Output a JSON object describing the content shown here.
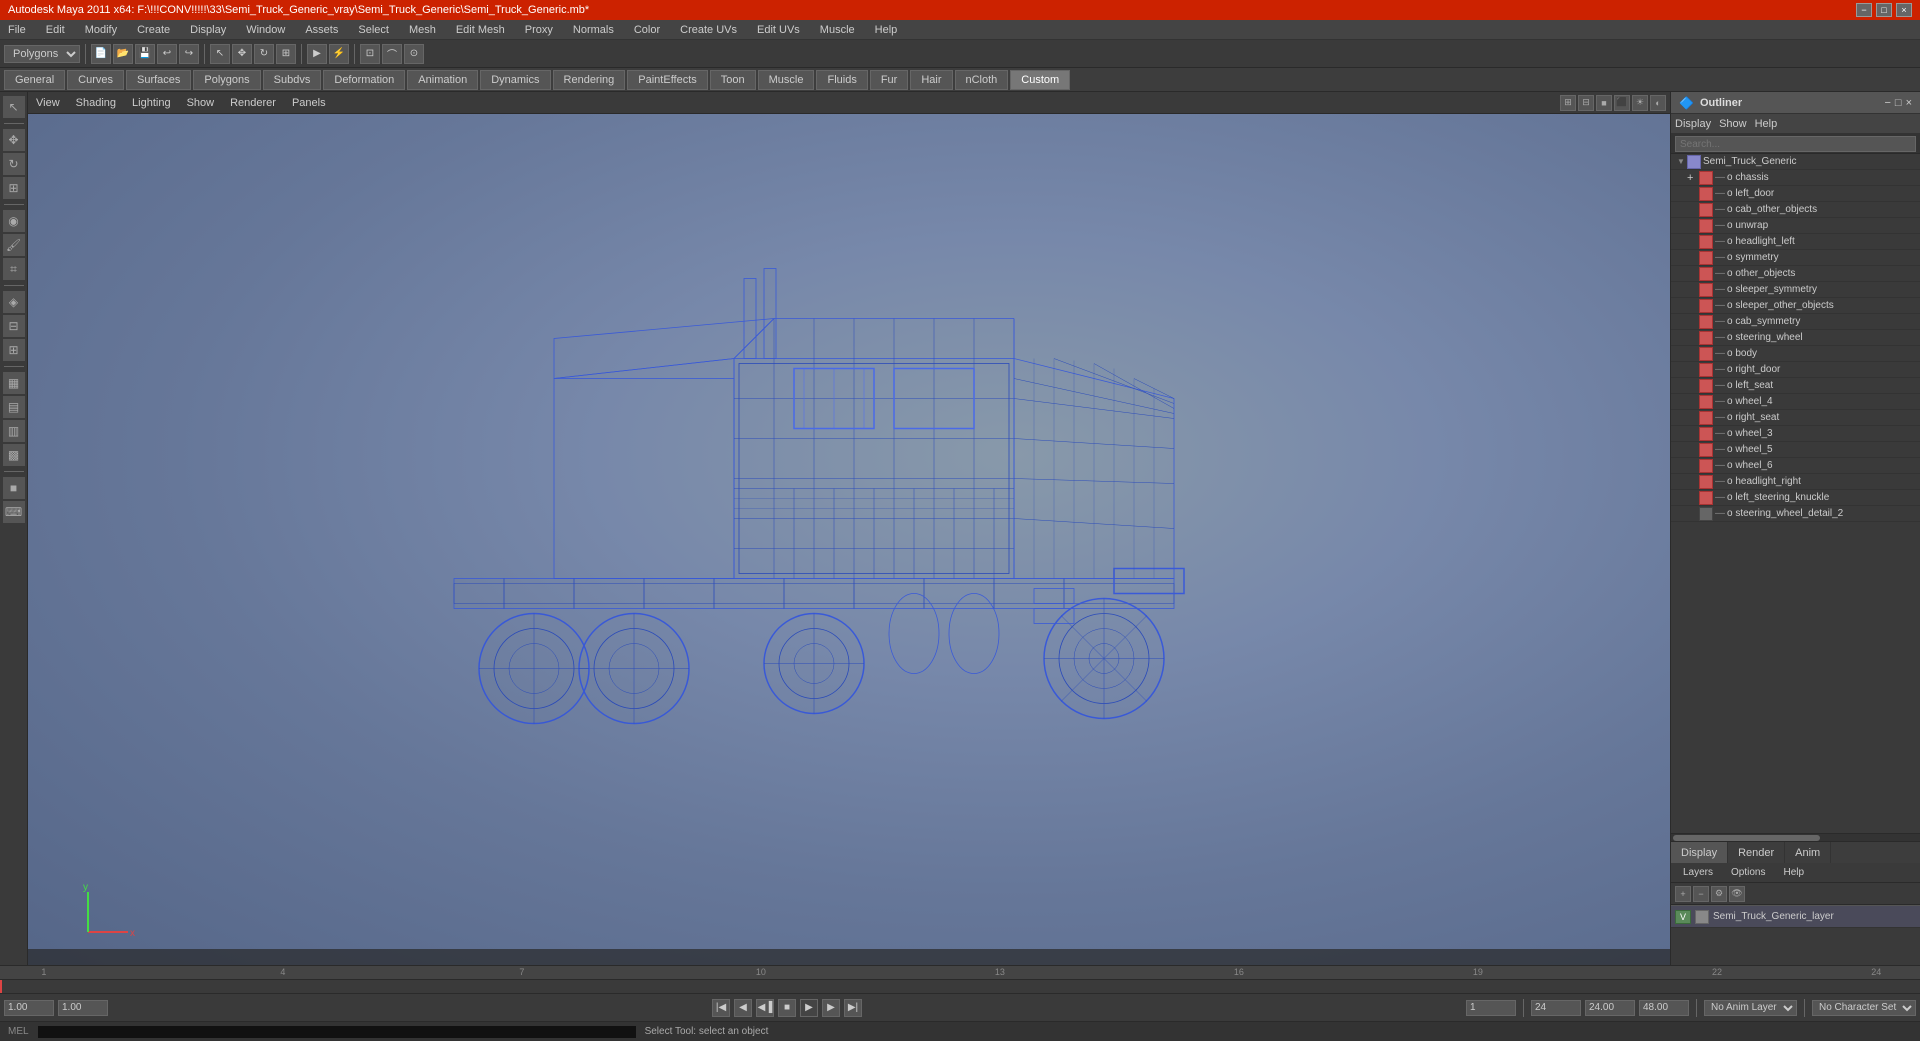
{
  "app": {
    "title": "Autodesk Maya 2011 x64: F:\\!!!CONV!!!!!\\33\\Semi_Truck_Generic_vray\\Semi_Truck_Generic\\Semi_Truck_Generic.mb*",
    "menu_items": [
      "File",
      "Edit",
      "Modify",
      "Create",
      "Display",
      "Window",
      "Assets",
      "Select",
      "Mesh",
      "Edit Mesh",
      "Proxy",
      "Normals",
      "Color",
      "Create UVs",
      "Edit UVs",
      "Muscle",
      "Help"
    ]
  },
  "toolbar": {
    "mode_select": "Polygons"
  },
  "tabs": {
    "items": [
      "General",
      "Curves",
      "Surfaces",
      "Polygons",
      "Subdvs",
      "Deformation",
      "Animation",
      "Dynamics",
      "Rendering",
      "PaintEffects",
      "Toon",
      "Muscle",
      "Fluids",
      "Fur",
      "Hair",
      "nCloth",
      "Custom"
    ],
    "active": "Custom"
  },
  "viewport": {
    "menus": [
      "View",
      "Shading",
      "Lighting",
      "Show",
      "Renderer",
      "Panels"
    ],
    "center_label": "",
    "axis": "y"
  },
  "outliner": {
    "title": "Outliner",
    "menus": [
      "Display",
      "Show",
      "Help"
    ],
    "tree": [
      {
        "label": "Semi_Truck_Generic",
        "level": 0,
        "expanded": true,
        "type": "root"
      },
      {
        "label": "chassis",
        "level": 1,
        "type": "mesh"
      },
      {
        "label": "left_door",
        "level": 1,
        "type": "mesh"
      },
      {
        "label": "cab_other_objects",
        "level": 1,
        "type": "group"
      },
      {
        "label": "unwrap",
        "level": 1,
        "type": "mesh"
      },
      {
        "label": "headlight_left",
        "level": 1,
        "type": "mesh"
      },
      {
        "label": "symmetry",
        "level": 1,
        "type": "mesh"
      },
      {
        "label": "other_objects",
        "level": 1,
        "type": "group"
      },
      {
        "label": "sleeper_symmetry",
        "level": 1,
        "type": "mesh"
      },
      {
        "label": "sleeper_other_objects",
        "level": 1,
        "type": "group"
      },
      {
        "label": "cab_symmetry",
        "level": 1,
        "type": "mesh"
      },
      {
        "label": "steering_wheel",
        "level": 1,
        "type": "mesh"
      },
      {
        "label": "body",
        "level": 1,
        "type": "mesh"
      },
      {
        "label": "right_door",
        "level": 1,
        "type": "mesh"
      },
      {
        "label": "left_seat",
        "level": 1,
        "type": "mesh"
      },
      {
        "label": "wheel_4",
        "level": 1,
        "type": "mesh"
      },
      {
        "label": "right_seat",
        "level": 1,
        "type": "mesh"
      },
      {
        "label": "wheel_3",
        "level": 1,
        "type": "mesh"
      },
      {
        "label": "wheel_5",
        "level": 1,
        "type": "mesh"
      },
      {
        "label": "wheel_6",
        "level": 1,
        "type": "mesh"
      },
      {
        "label": "headlight_right",
        "level": 1,
        "type": "mesh"
      },
      {
        "label": "left_steering_knuckle",
        "level": 1,
        "type": "mesh"
      },
      {
        "label": "steering_wheel_detail_2",
        "level": 1,
        "type": "mesh"
      }
    ],
    "bottom_tabs": [
      "Display",
      "Render",
      "Anim"
    ],
    "active_bottom_tab": "Display",
    "layer_tabs": [
      "Layers",
      "Options",
      "Help"
    ],
    "layer": {
      "v_label": "V",
      "name": "Semi_Truck_Generic_layer"
    }
  },
  "timeline": {
    "marks": [
      "1",
      "",
      "",
      "4",
      "",
      "",
      "7",
      "",
      "",
      "10",
      "",
      "",
      "13",
      "",
      "",
      "16",
      "",
      "",
      "19",
      "",
      "",
      "22",
      "",
      "",
      "24"
    ],
    "start": "1.00",
    "end": "24",
    "current": "1",
    "range_start": "1.00",
    "range_end": "24.00",
    "max": "48.00"
  },
  "bottom_controls": {
    "anim_start": "1.00",
    "anim_end": "1.00",
    "current_frame": "1",
    "end_frame": "24",
    "no_anim_layer": "No Anim Layer",
    "no_char_set": "No Character Set"
  },
  "status_bar": {
    "mel_label": "MEL",
    "status_text": "Select Tool: select an object"
  },
  "icons": {
    "expand_plus": "+",
    "expand_minus": "−",
    "minimize": "−",
    "maximize": "□",
    "close": "×",
    "play": "▶",
    "rewind": "◀◀",
    "step_back": "◀",
    "step_fwd": "▶",
    "fast_fwd": "▶▶",
    "end": "▶|"
  }
}
